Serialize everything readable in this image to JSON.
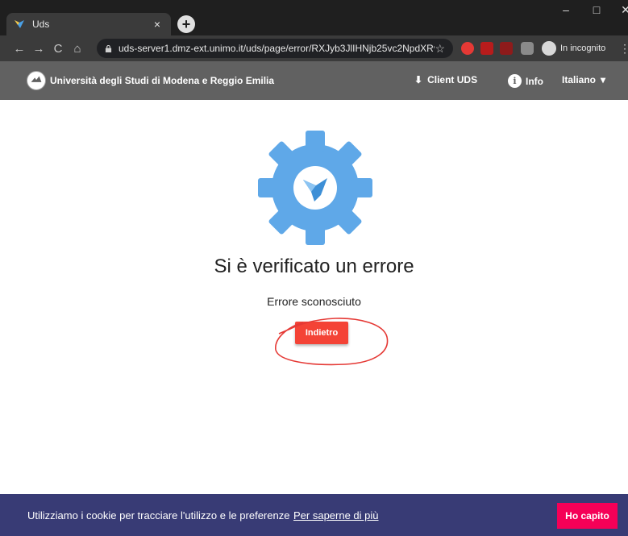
{
  "browser": {
    "tab_title": "Uds",
    "tab_close": "×",
    "new_tab": "+",
    "url": "uds-server1.dmz-ext.unimo.it/uds/page/error/RXJyb3JlIHNjb25vc2NpdXRv",
    "incognito_label": "In incognito",
    "win_min": "–",
    "win_max": "□",
    "win_close": "✕",
    "back": "←",
    "forward": "→",
    "reload": "C",
    "home": "⌂",
    "star": "☆",
    "menu": "⋮"
  },
  "header": {
    "site_name": "Università degli Studi di Modena e Reggio Emilia",
    "client_label": "Client UDS",
    "info_label": "Info",
    "info_icon": "i",
    "lang_label": "Italiano",
    "download_icon": "⬇",
    "caret_icon": "▾"
  },
  "main": {
    "title": "Si è verificato un errore",
    "subtitle": "Errore sconosciuto",
    "back_button": "Indietro"
  },
  "cookie": {
    "text": "Utilizziamo i cookie per tracciare l'utilizzo e le preferenze",
    "link": "Per saperne di più",
    "accept_button": "Ho capito"
  },
  "colors": {
    "header_bg": "#616161",
    "gear": "#5fa8e8",
    "back_button_bg": "#f44336",
    "cookie_bg": "#383b75",
    "accept_bg": "#f50057",
    "annotation": "#e53935"
  }
}
